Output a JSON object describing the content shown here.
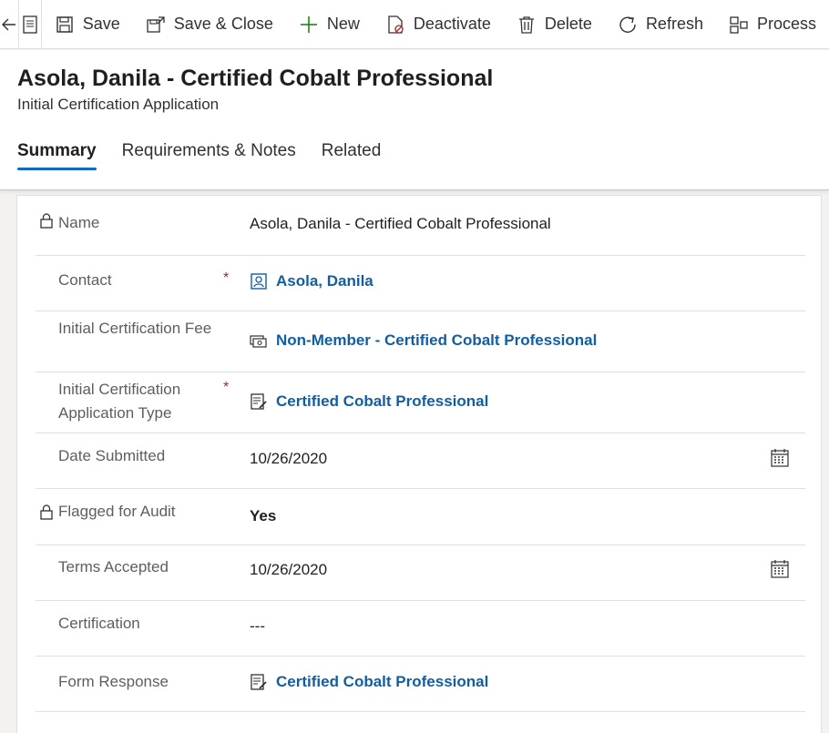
{
  "toolbar": {
    "save": "Save",
    "save_close": "Save & Close",
    "new": "New",
    "deactivate": "Deactivate",
    "delete": "Delete",
    "refresh": "Refresh",
    "process": "Process"
  },
  "header": {
    "title": "Asola, Danila - Certified Cobalt Professional",
    "subtitle": "Initial Certification Application"
  },
  "tabs": [
    "Summary",
    "Requirements & Notes",
    "Related"
  ],
  "fields": {
    "name": {
      "label": "Name",
      "value": "Asola, Danila - Certified Cobalt Professional"
    },
    "contact": {
      "label": "Contact",
      "required": "*",
      "value": "Asola, Danila"
    },
    "fee": {
      "label": "Initial Certification Fee",
      "value": "Non-Member - Certified Cobalt Professional"
    },
    "app_type": {
      "label": "Initial Certification Application Type",
      "required": "*",
      "value": "Certified Cobalt Professional"
    },
    "date_submitted": {
      "label": "Date Submitted",
      "value": "10/26/2020"
    },
    "flagged": {
      "label": "Flagged for Audit",
      "value": "Yes"
    },
    "terms": {
      "label": "Terms Accepted",
      "value": "10/26/2020"
    },
    "certification": {
      "label": "Certification",
      "value": "---"
    },
    "form_response": {
      "label": "Form Response",
      "value": "Certified Cobalt Professional"
    }
  },
  "colors": {
    "accent": "#0f6cbd",
    "link": "#115ea3",
    "required": "#a4262c"
  }
}
